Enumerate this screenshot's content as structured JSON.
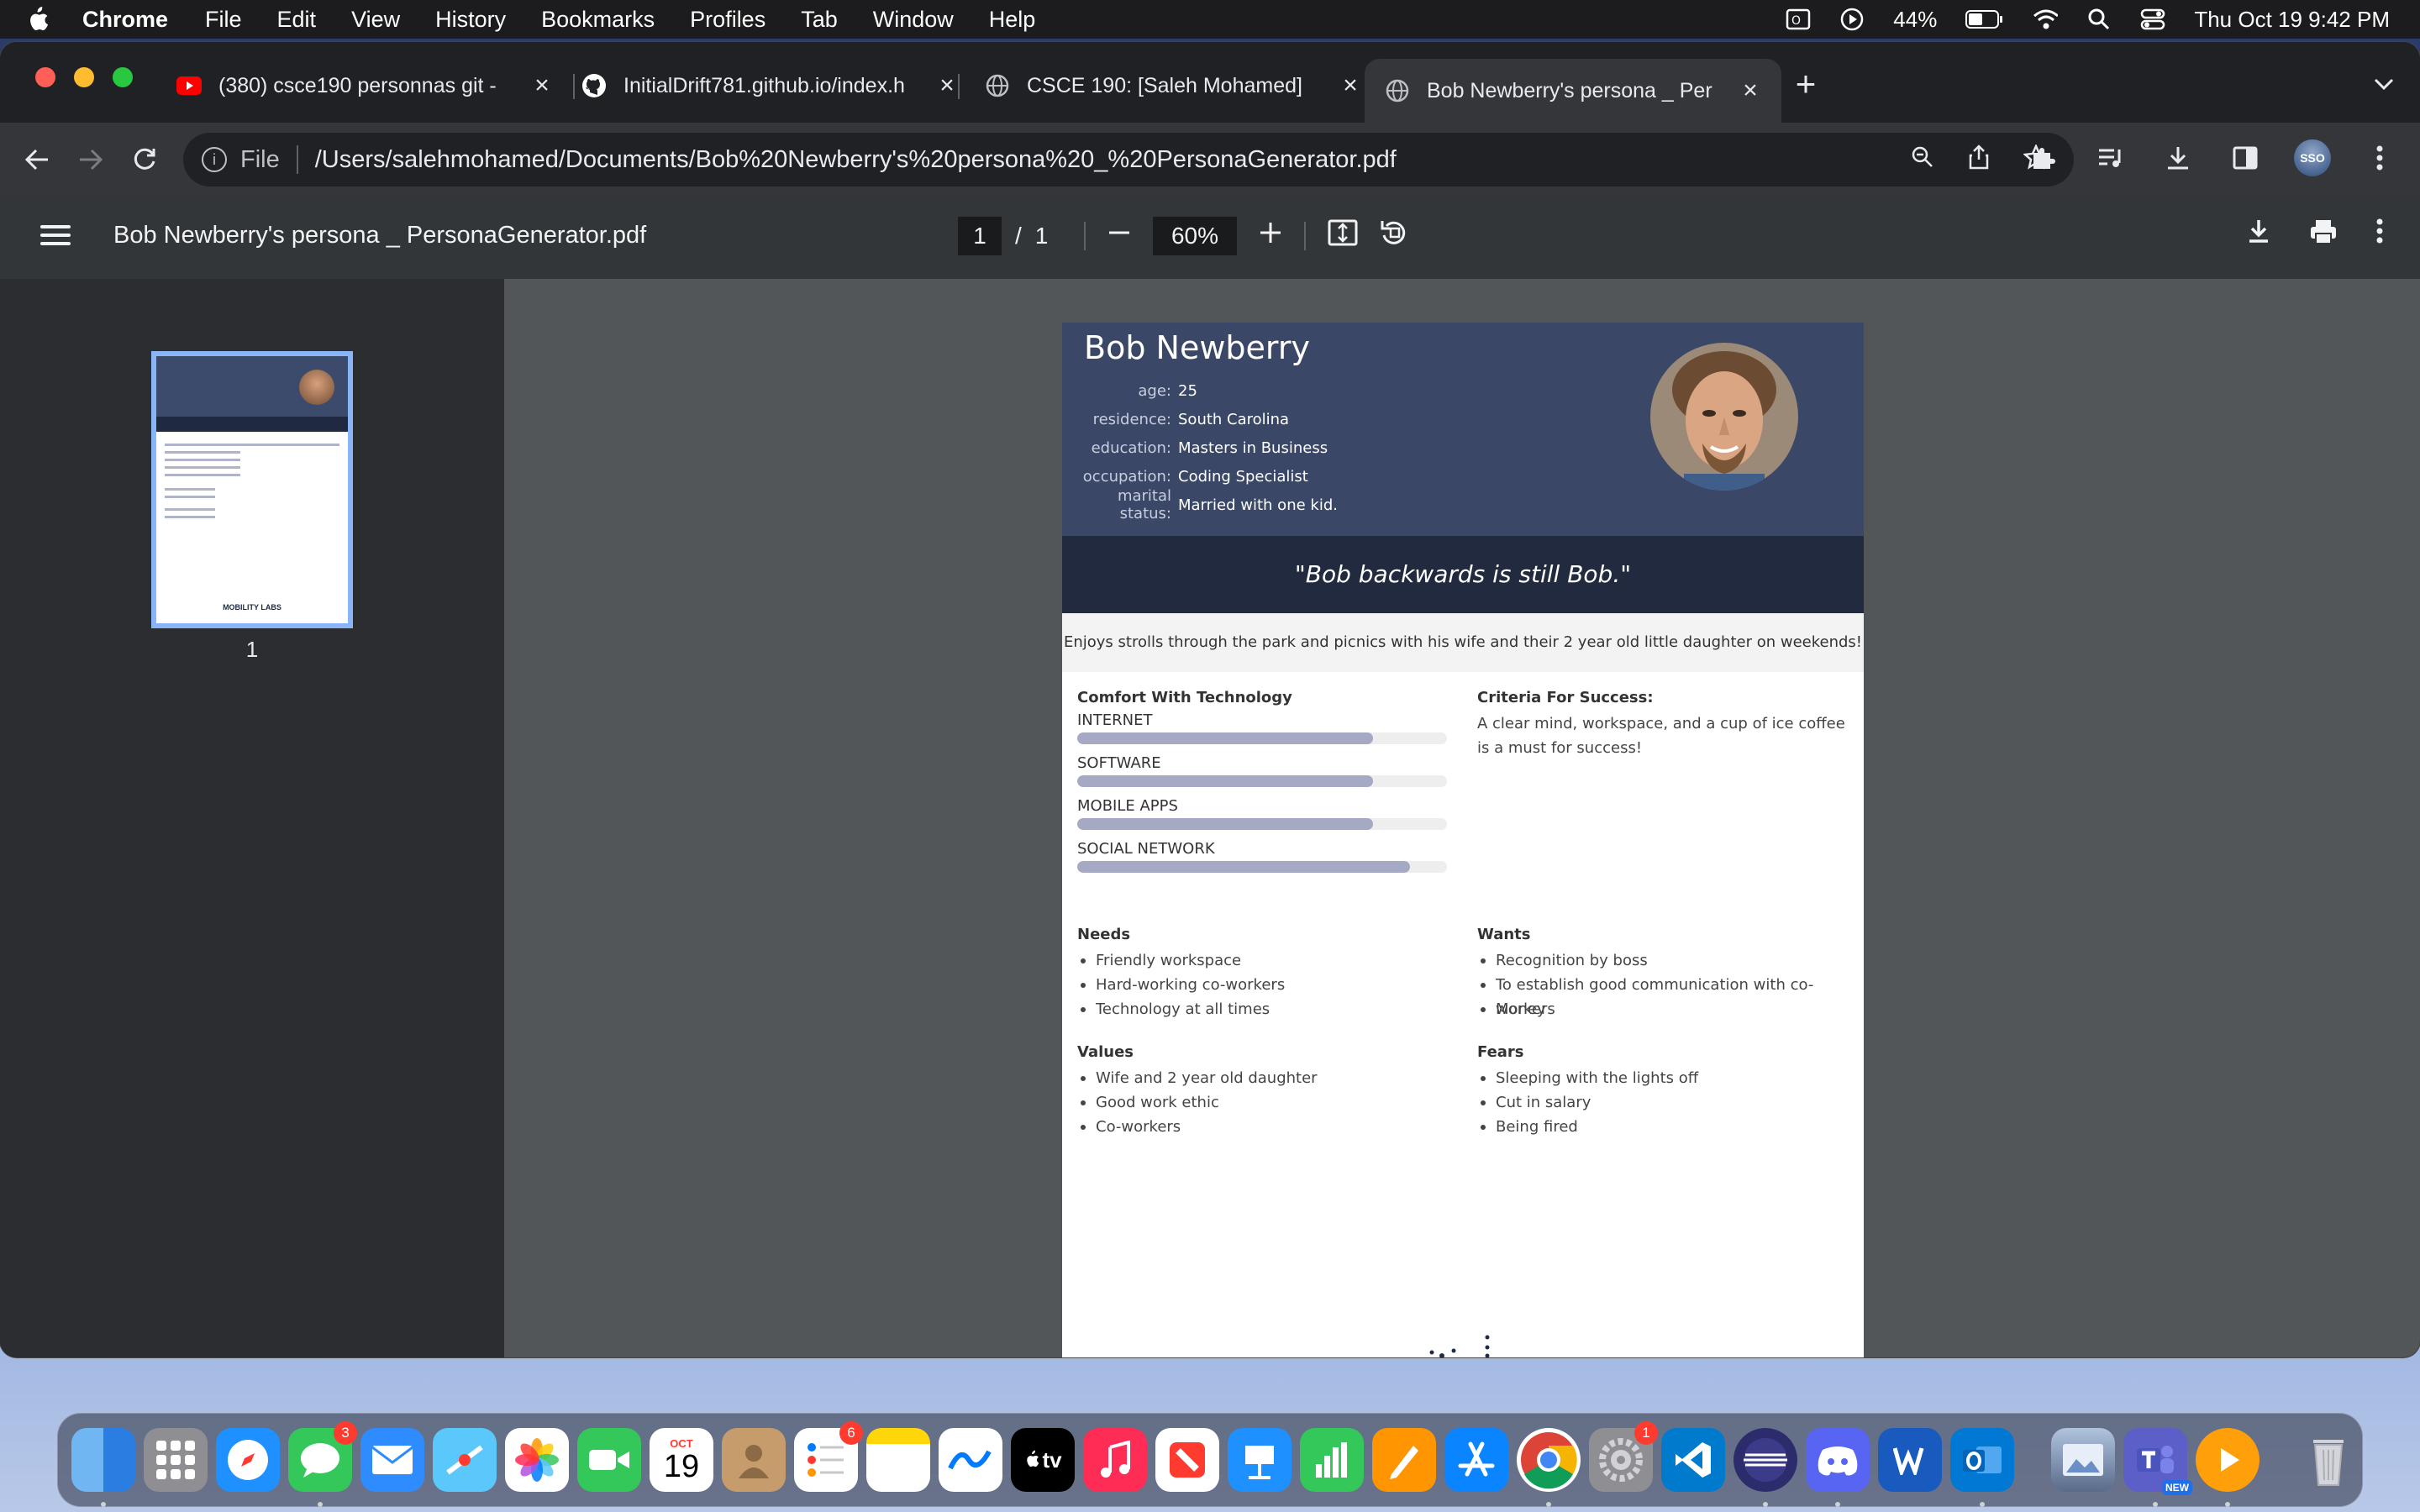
{
  "menubar": {
    "app": "Chrome",
    "items": [
      "File",
      "Edit",
      "View",
      "History",
      "Bookmarks",
      "Profiles",
      "Tab",
      "Window",
      "Help"
    ],
    "battery": "44%",
    "datetime": "Thu Oct 19  9:42 PM"
  },
  "tabs": [
    {
      "title": "(380) csce190 personnas git -",
      "icon": "youtube-icon"
    },
    {
      "title": "InitialDrift781.github.io/index.h",
      "icon": "github-icon"
    },
    {
      "title": "CSCE 190: [Saleh Mohamed]",
      "icon": "globe-icon"
    },
    {
      "title": "Bob Newberry's persona _ Per",
      "icon": "globe-icon"
    }
  ],
  "omnibox": {
    "scheme": "File",
    "url": "/Users/salehmohamed/Documents/Bob%20Newberry's%20persona%20_%20PersonaGenerator.pdf"
  },
  "profile_badge": "SSO",
  "pdf": {
    "filename": "Bob Newberry's persona _ PersonaGenerator.pdf",
    "page_current": "1",
    "page_sep": "/",
    "page_total": "1",
    "zoom": "60%",
    "thumb_number": "1"
  },
  "persona": {
    "name": "Bob Newberry",
    "facts": [
      {
        "key": "age:",
        "value": "25"
      },
      {
        "key": "residence:",
        "value": "South Carolina"
      },
      {
        "key": "education:",
        "value": "Masters in Business"
      },
      {
        "key": "occupation:",
        "value": "Coding Specialist"
      },
      {
        "key": "marital status:",
        "value": "Married with one kid."
      }
    ],
    "quote": "\"Bob backwards is still Bob.\"",
    "bio": "Enjoys strolls through the park and picnics with his wife and their 2 year old little daughter on weekends!",
    "comfort_heading": "Comfort With Technology",
    "comfort": [
      {
        "label": "INTERNET",
        "level": 0.8
      },
      {
        "label": "SOFTWARE",
        "level": 0.8
      },
      {
        "label": "MOBILE APPS",
        "level": 0.8
      },
      {
        "label": "SOCIAL NETWORK",
        "level": 0.9
      }
    ],
    "criteria_heading": "Criteria For Success:",
    "criteria_text": "A clear mind, workspace, and a cup of ice coffee is a must for success!",
    "needs_heading": "Needs",
    "needs": [
      "Friendly workspace",
      "Hard-working co-workers",
      "Technology at all times"
    ],
    "wants_heading": "Wants",
    "wants": [
      "Recognition by boss",
      "To establish good communication with co-workers",
      "Money"
    ],
    "values_heading": "Values",
    "values": [
      "Wife and 2 year old daughter",
      "Good work ethic",
      "Co-workers"
    ],
    "fears_heading": "Fears",
    "fears": [
      "Sleeping with the lights off",
      "Cut in salary",
      "Being fired"
    ],
    "logo_bold": "MOBILITY",
    "logo_thin": "LABS"
  },
  "dock": {
    "calendar_month": "OCT",
    "calendar_day": "19",
    "badges": {
      "messages": "3",
      "reminders": "6",
      "settings": "1"
    },
    "teams_tag": "NEW",
    "tv_label": "tv"
  },
  "colors": {
    "header_bg": "#3a4766",
    "quote_bg": "#212a3e",
    "bar_fill": "#a5a9c4",
    "thumb_border": "#8ab4f8"
  }
}
